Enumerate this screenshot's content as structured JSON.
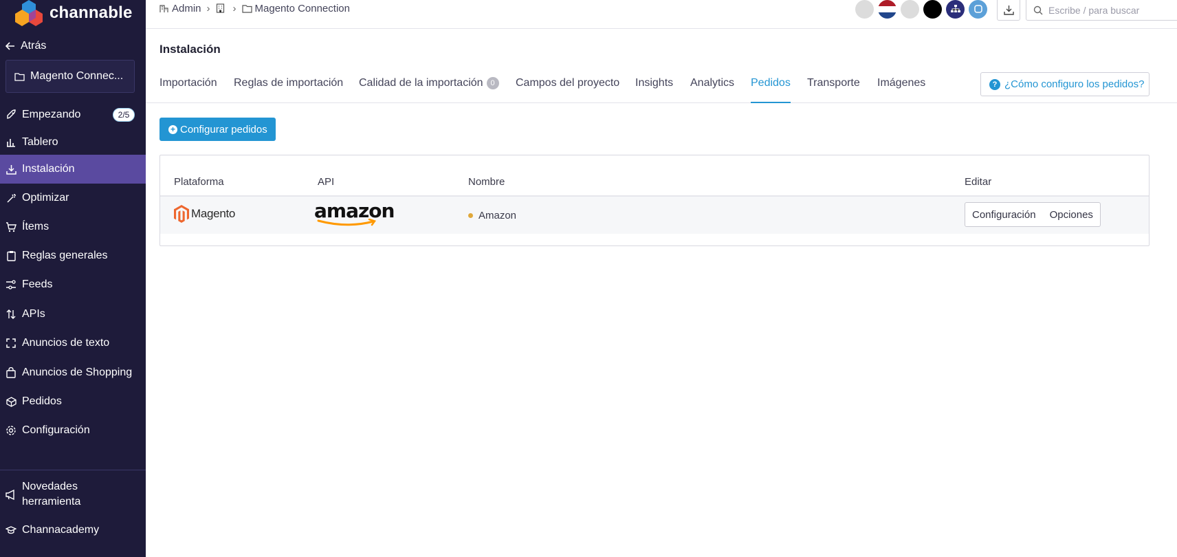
{
  "brand": {
    "name": "channable"
  },
  "sidebar": {
    "back_label": "Atrás",
    "project": "Magento Connec...",
    "items": [
      {
        "label": "Empezando",
        "icon": "rocket-icon",
        "badge": "2/5"
      },
      {
        "label": "Tablero",
        "icon": "bar-chart-icon"
      },
      {
        "label": "Instalación",
        "icon": "install-icon",
        "active": true
      },
      {
        "label": "Optimizar",
        "icon": "magic-wand-icon"
      },
      {
        "label": "Ítems",
        "icon": "cart-icon"
      },
      {
        "label": "Reglas generales",
        "icon": "clipboard-icon"
      },
      {
        "label": "Feeds",
        "icon": "feeds-icon"
      },
      {
        "label": "APIs",
        "icon": "arrows-updown-icon"
      },
      {
        "label": "Anuncios de texto",
        "icon": "expand-icon"
      },
      {
        "label": "Anuncios de Shopping",
        "icon": "shopping-bag-icon"
      },
      {
        "label": "Pedidos",
        "icon": "box-icon"
      },
      {
        "label": "Configuración",
        "icon": "gear-icon"
      }
    ],
    "bottom_items": [
      {
        "label": "Novedades herramienta",
        "icon": "megaphone-icon"
      },
      {
        "label": "Channacademy",
        "icon": "graduation-cap-icon"
      }
    ]
  },
  "topbar": {
    "breadcrumb": [
      "Admin",
      "Magento Connection"
    ],
    "search_placeholder": "Escribe / para buscar"
  },
  "page": {
    "title": "Instalación",
    "tabs": [
      {
        "label": "Importación"
      },
      {
        "label": "Reglas de importación"
      },
      {
        "label": "Calidad de la importación",
        "count": "0"
      },
      {
        "label": "Campos del proyecto"
      },
      {
        "label": "Insights"
      },
      {
        "label": "Analytics"
      },
      {
        "label": "Pedidos",
        "active": true
      },
      {
        "label": "Transporte"
      },
      {
        "label": "Imágenes"
      }
    ],
    "help_button": "¿Cómo configuro los pedidos?",
    "configure_button": "Configurar pedidos"
  },
  "table": {
    "columns": [
      "Plataforma",
      "API",
      "Nombre",
      "Editar"
    ],
    "rows": [
      {
        "platform": "Magento",
        "api": "amazon",
        "name": "Amazon",
        "status_color": "#e0a83a",
        "actions": [
          "Configuración",
          "Opciones"
        ]
      }
    ]
  },
  "colors": {
    "sidebar_bg": "#1e1b3a",
    "sidebar_active": "#5a4aa0",
    "accent": "#2395d3",
    "magento_orange": "#ee672f",
    "amazon_orange": "#ff9900"
  }
}
